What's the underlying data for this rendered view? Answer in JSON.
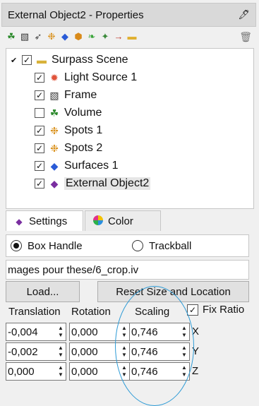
{
  "window": {
    "title": "External Object2 - Properties",
    "pin_icon": "pin-icon"
  },
  "toolbar": {
    "icons": [
      "surface-add-icon",
      "frame-add-icon",
      "light-add-icon",
      "spots-add-icon",
      "surfaces-add-icon",
      "cells-add-icon",
      "filaments-add-icon",
      "measurement-add-icon",
      "reference-add-icon",
      "folder-add-icon"
    ],
    "trash_icon": "trash-icon"
  },
  "tree": {
    "root": {
      "label": "Surpass Scene",
      "checked": true,
      "expanded": true
    },
    "items": [
      {
        "label": "Light Source 1",
        "checked": true
      },
      {
        "label": "Frame",
        "checked": true
      },
      {
        "label": "Volume",
        "checked": false
      },
      {
        "label": "Spots 1",
        "checked": true
      },
      {
        "label": "Spots 2",
        "checked": true
      },
      {
        "label": "Surfaces 1",
        "checked": true
      },
      {
        "label": "External Object2",
        "checked": true,
        "selected": true
      }
    ]
  },
  "tabs": [
    {
      "label": "Settings",
      "active": true
    },
    {
      "label": "Color",
      "active": false
    }
  ],
  "settings": {
    "mode_options": [
      {
        "label": "Box Handle",
        "selected": true
      },
      {
        "label": "Trackball",
        "selected": false
      }
    ],
    "file_path": "mages pour these/6_crop.iv",
    "load_label": "Load...",
    "reset_label": "Reset Size and Location",
    "headers": {
      "translation": "Translation",
      "rotation": "Rotation",
      "scaling": "Scaling"
    },
    "fix_ratio": {
      "label": "Fix Ratio",
      "checked": true
    },
    "rows": [
      {
        "axis": "X",
        "translation": "-0,004",
        "rotation": "0,000",
        "scaling": "0,746"
      },
      {
        "axis": "Y",
        "translation": "-0,002",
        "rotation": "0,000",
        "scaling": "0,746"
      },
      {
        "axis": "Z",
        "translation": "0,000",
        "rotation": "0,000",
        "scaling": "0,746"
      }
    ]
  },
  "colors": {
    "annotation_ellipse": "#2e9bd6",
    "selection": "#e6e6e6"
  }
}
